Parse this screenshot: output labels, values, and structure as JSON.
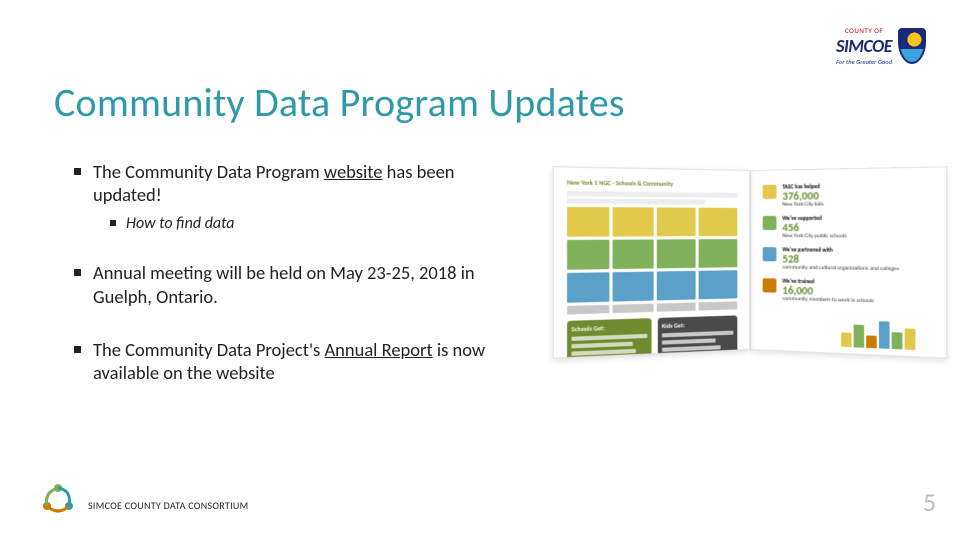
{
  "brand": {
    "county_of": "COUNTY OF",
    "name": "SIMCOE",
    "tagline": "For the Greater Good"
  },
  "title": "Community Data Program Updates",
  "bullets": [
    {
      "pre": "The Community Data Program ",
      "link": "website",
      "post": " has been updated!",
      "sub": "How to find data"
    },
    {
      "pre": "Annual meeting will be held on May 23-25, 2018 in Guelph, Ontario.",
      "link": "",
      "post": ""
    },
    {
      "pre": "The Community Data Project's ",
      "link": "Annual Report",
      "post": " is now available on the website"
    }
  ],
  "report_image": {
    "left_page": {
      "heading": "New York 1 NGC ‑ Schools & Community",
      "cards": {
        "a": "Schools Get:",
        "b": "Kids Get:"
      }
    },
    "right_page": {
      "stats": [
        {
          "big": "TASC has helped",
          "num": "376,000",
          "tail": "New York City kids"
        },
        {
          "big": "We've supported",
          "num": "456",
          "tail": "New York City public schools"
        },
        {
          "big": "We've partnered with",
          "num": "528",
          "tail": "community and cultural organizations and colleges"
        },
        {
          "big": "We've trained",
          "num": "16,000",
          "tail": "community members to work in schools"
        }
      ]
    }
  },
  "footer": {
    "text": "SIMCOE COUNTY DATA CONSORTIUM",
    "page_number": "5"
  },
  "colors": {
    "title": "#2e9aa8",
    "brand_blue": "#1a2a78",
    "brand_red": "#a00",
    "accent_green": "#6e8b2f"
  }
}
